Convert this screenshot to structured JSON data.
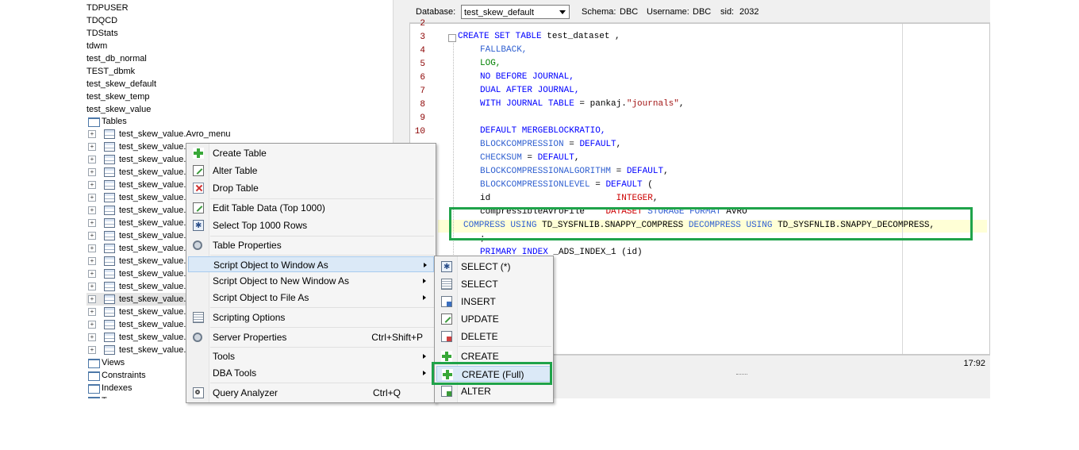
{
  "tree": {
    "databases": [
      "TDPUSER",
      "TDQCD",
      "TDStats",
      "tdwm",
      "test_db_normal",
      "TEST_dbmk",
      "test_skew_default",
      "test_skew_temp",
      "test_skew_value"
    ],
    "tables_folder": "Tables",
    "tables": [
      "test_skew_value.Avro_menu",
      "test_skew_value.a",
      "test_skew_value.a",
      "test_skew_value.c",
      "test_skew_value.E",
      "test_skew_value.T",
      "test_skew_value.T",
      "test_skew_value.T",
      "test_skew_value.T",
      "test_skew_value.T",
      "test_skew_value.T",
      "test_skew_value.T",
      "test_skew_value.T",
      "test_skew_value.",
      "test_skew_value.",
      "test_skew_value.",
      "test_skew_value.",
      "test_skew_value.T"
    ],
    "views_folder": "Views",
    "constraints_folder": "Constraints",
    "indexes_folder": "Indexes",
    "cut_item": "T"
  },
  "db_bar": {
    "database_label": "Database:",
    "database_value": "test_skew_default",
    "schema_label": "Schema:",
    "schema_value": "DBC",
    "username_label": "Username:",
    "username_value": "DBC",
    "sid_label": "sid:",
    "sid_value": "2032"
  },
  "code": {
    "line_numbers": [
      "2",
      "3",
      "4",
      "5",
      "6",
      "7",
      "8",
      "9",
      "10"
    ],
    "l3a": "CREATE SET TABLE",
    "l3b": " test_dataset ,",
    "l4": "FALLBACK,",
    "l5": "LOG,",
    "l6": "NO BEFORE JOURNAL,",
    "l7": "DUAL AFTER JOURNAL,",
    "l8a": "WITH JOURNAL TABLE",
    "l8b": " = pankaj.",
    "l8c": "\"journals\"",
    "l8d": ",",
    "l10a": "DEFAULT MERGEBLOCKRATIO,",
    "l11a": "BLOCKCOMPRESSION",
    "l11b": " = ",
    "l11c": "DEFAULT",
    "l11d": ",",
    "l12a": "CHECKSUM",
    "l12b": " = ",
    "l12c": "DEFAULT",
    "l12d": ",",
    "l13a": "BLOCKCOMPRESSIONALGORITHM",
    "l13b": " = ",
    "l13c": "DEFAULT",
    "l13d": ",",
    "l14a": "BLOCKCOMPRESSIONLEVEL",
    "l14b": " = ",
    "l14c": "DEFAULT",
    "l14d": " (",
    "l15a": "id                        ",
    "l15b": "INTEGER",
    "l15c": ",",
    "l16a": "compressibleAvroFile    ",
    "l16b": "DATASET",
    "l16c": " STORAGE FORMAT",
    "l16d": " AVRO",
    "l17a": "COMPRESS USING",
    "l17b": " TD_SYSFNLIB.SNAPPY_COMPRESS ",
    "l17c": "DECOMPRESS USING",
    "l17d": " TD_SYSFNLIB.SNAPPY_DECOMPRESS,",
    "l18": ";",
    "l19a": "PRIMARY INDEX",
    "l19b": " _ADS_INDEX_1 (id)"
  },
  "status": {
    "position": "17:92"
  },
  "context_menu": {
    "create_table": "Create Table",
    "alter_table": "Alter Table",
    "drop_table": "Drop Table",
    "edit_table_data": "Edit Table Data (Top 1000)",
    "select_top": "Select Top 1000 Rows",
    "table_properties": "Table Properties",
    "script_window": "Script Object to Window As",
    "script_new_window": "Script Object to New Window As",
    "script_file": "Script Object to File As",
    "scripting_options": "Scripting Options",
    "server_properties": "Server Properties",
    "server_properties_shortcut": "Ctrl+Shift+P",
    "tools": "Tools",
    "dba_tools": "DBA Tools",
    "query_analyzer": "Query Analyzer",
    "query_analyzer_shortcut": "Ctrl+Q"
  },
  "sub_menu": {
    "select_star": "SELECT (*)",
    "select": "SELECT",
    "insert": "INSERT",
    "update": "UPDATE",
    "delete": "DELETE",
    "create": "CREATE",
    "create_full": "CREATE (Full)",
    "alter": "ALTER"
  },
  "colors": {
    "highlight_box": "#1fa34a",
    "keyword": "#0000ff",
    "type_red": "#cc0000",
    "menu_hover": "#dbe9f7"
  }
}
